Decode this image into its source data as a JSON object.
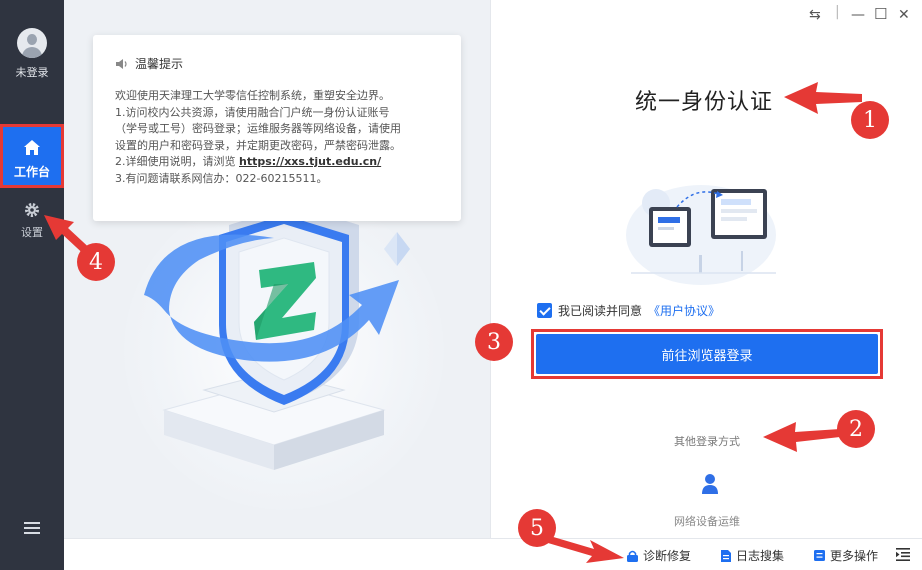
{
  "sidebar": {
    "user_label": "未登录",
    "work_label": "工作台",
    "settings_label": "设置"
  },
  "tip": {
    "title": "温馨提示",
    "line1": "欢迎使用天津理工大学零信任控制系统，重塑安全边界。",
    "line2": "1.访问校内公共资源，请使用融合门户统一身份认证账号",
    "line3": "（学号或工号）密码登录；运维服务器等网络设备，请使用",
    "line4": "设置的用户和密码登录，并定期更改密码，严禁密码泄露。",
    "line5_prefix": "2.详细使用说明，请浏览 ",
    "line5_link": "https://xxs.tjut.edu.cn/",
    "line6": "3.有问题请联系网信办：022-60215511。"
  },
  "login": {
    "title": "统一身份认证",
    "agree_text": "我已阅读并同意",
    "agreement_link": "《用户协议》",
    "button_label": "前往浏览器登录",
    "other_methods": "其他登录方式",
    "net_device": "网络设备运维"
  },
  "window": {
    "swap_icon": "⇆",
    "minimize": "—",
    "maximize": "☐",
    "close": "✕"
  },
  "bottombar": {
    "diagnose": "诊断修复",
    "log_collect": "日志搜集",
    "more": "更多操作"
  },
  "annotations": {
    "n1": "1",
    "n2": "2",
    "n3": "3",
    "n4": "4",
    "n5": "5"
  },
  "colors": {
    "accent": "#1e6ff0",
    "sidebar": "#2f3440",
    "annotation": "#e53935"
  }
}
